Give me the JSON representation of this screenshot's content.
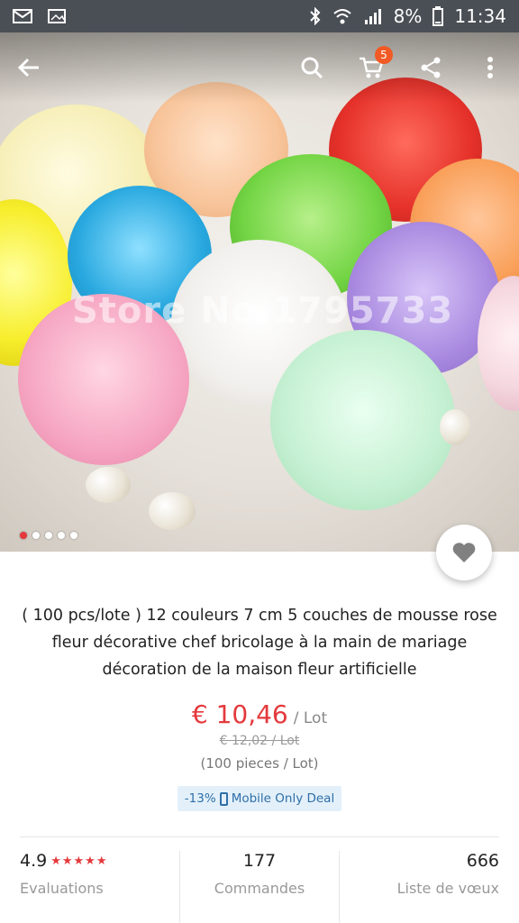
{
  "status_bar": {
    "battery": "8%",
    "time": "11:34"
  },
  "header": {
    "cart_count": "5"
  },
  "gallery": {
    "watermark": "Store No.1795733",
    "slide_count": 5,
    "active_slide": 1
  },
  "product": {
    "title": "( 100 pcs/lote ) 12 couleurs 7 cm 5 couches de mousse rose fleur décorative chef bricolage à la main de mariage décoration de la maison fleur artificielle",
    "price": "€ 10,46",
    "unit": "/ Lot",
    "old_price": "€ 12,02 / Lot",
    "pieces": "(100 pieces / Lot)",
    "deal_discount": "-13%",
    "deal_label": "Mobile Only Deal"
  },
  "stats": {
    "rating": "4.9",
    "stars": "★★★★★",
    "evaluations_label": "Evaluations",
    "orders": "177",
    "orders_label": "Commandes",
    "wishlist": "666",
    "wishlist_label": "Liste de vœux"
  },
  "colors": {
    "accent": "#e4393c",
    "badge": "#f15a24",
    "deal_bg": "#e3f0fa",
    "deal_text": "#2f6fa8"
  }
}
